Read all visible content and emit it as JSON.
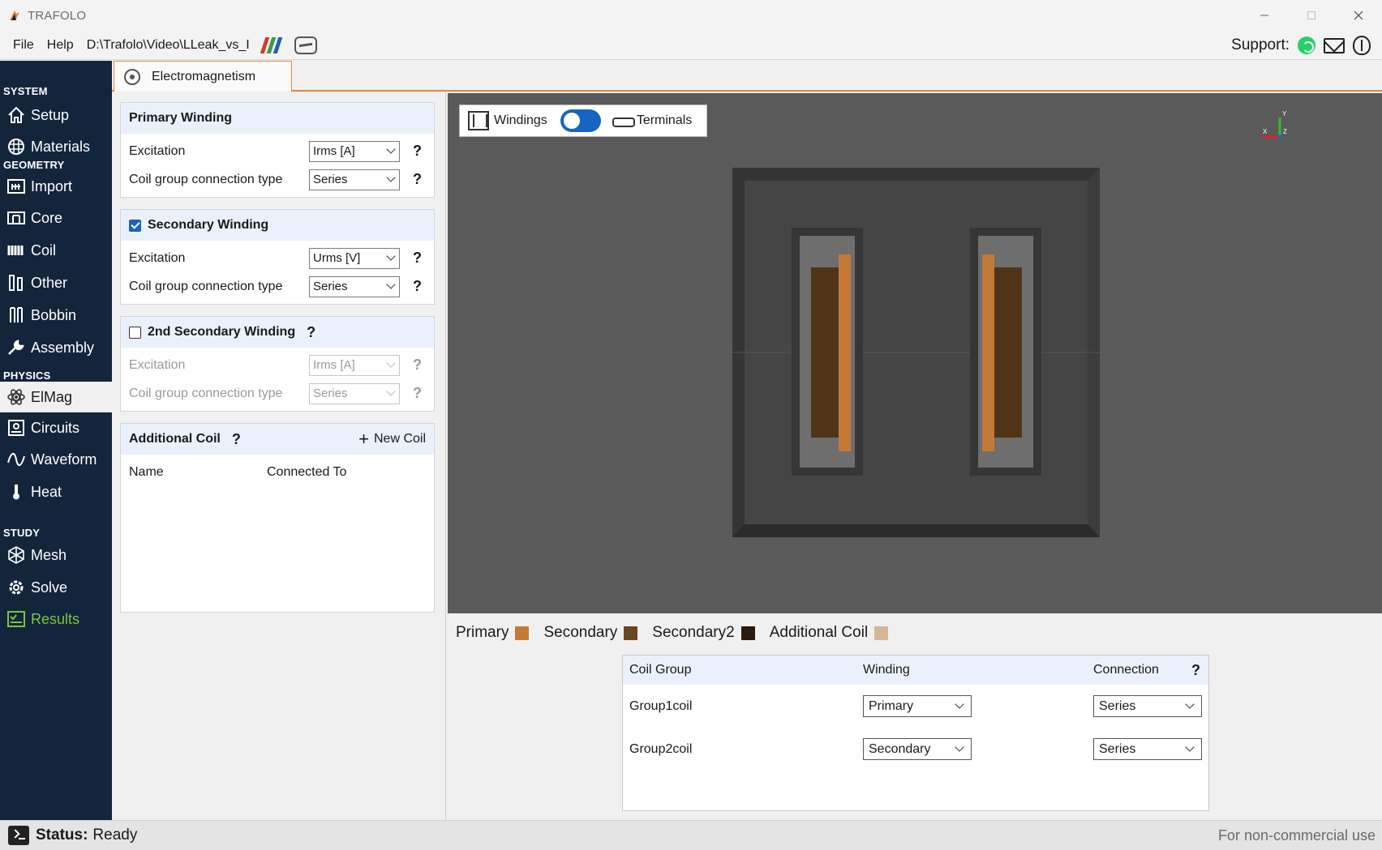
{
  "window": {
    "title": "TRAFOLO"
  },
  "menu": {
    "file": "File",
    "help": "Help",
    "filepath": "D:\\Trafolo\\Video\\LLeak_vs_I"
  },
  "support": {
    "label": "Support:"
  },
  "sidebar": {
    "sections": {
      "system": "SYSTEM",
      "geometry": "GEOMETRY",
      "physics": "PHYSICS",
      "study": "STUDY"
    },
    "items": {
      "setup": "Setup",
      "materials": "Materials",
      "import": "Import",
      "core": "Core",
      "coil": "Coil",
      "other": "Other",
      "bobbin": "Bobbin",
      "assembly": "Assembly",
      "elmag": "ElMag",
      "circuits": "Circuits",
      "waveform": "Waveform",
      "heat": "Heat",
      "mesh": "Mesh",
      "solve": "Solve",
      "results": "Results"
    },
    "active": "elmag"
  },
  "tab": {
    "label": "Electromagnetism"
  },
  "primary": {
    "title": "Primary Winding",
    "excitation_label": "Excitation",
    "excitation_value": "Irms [A]",
    "connection_label": "Coil group connection type",
    "connection_value": "Series"
  },
  "secondary": {
    "title": "Secondary Winding",
    "checked": true,
    "excitation_label": "Excitation",
    "excitation_value": "Urms [V]",
    "connection_label": "Coil group connection type",
    "connection_value": "Series"
  },
  "secondary2": {
    "title": "2nd Secondary Winding",
    "checked": false,
    "excitation_label": "Excitation",
    "excitation_value": "Irms [A]",
    "connection_label": "Coil group connection type",
    "connection_value": "Series"
  },
  "additional": {
    "title": "Additional Coil",
    "new_coil": "New Coil",
    "col_name": "Name",
    "col_connected": "Connected To"
  },
  "help_symbol": "?",
  "viewport": {
    "windings_label": "Windings",
    "terminals_label": "Terminals",
    "toggle_on": true,
    "axes": {
      "x": "X",
      "y": "Y",
      "z": "Z"
    }
  },
  "legend": [
    {
      "label": "Primary",
      "color": "#c47a36"
    },
    {
      "label": "Secondary",
      "color": "#6b4621"
    },
    {
      "label": "Secondary2",
      "color": "#2b1a0e"
    },
    {
      "label": "Additional Coil",
      "color": "#d4b79a"
    }
  ],
  "coil_table": {
    "headers": {
      "group": "Coil Group",
      "winding": "Winding",
      "connection": "Connection"
    },
    "rows": [
      {
        "group": "Group1coil",
        "winding": "Primary",
        "connection": "Series"
      },
      {
        "group": "Group2coil",
        "winding": "Secondary",
        "connection": "Series"
      }
    ]
  },
  "status": {
    "label": "Status:",
    "value": "Ready",
    "license": "For non-commercial use"
  },
  "colors": {
    "sidebar_bg": "#13253a",
    "accent_orange": "#e8853a",
    "toggle_blue": "#1665c0",
    "results_green": "#7fc243"
  }
}
